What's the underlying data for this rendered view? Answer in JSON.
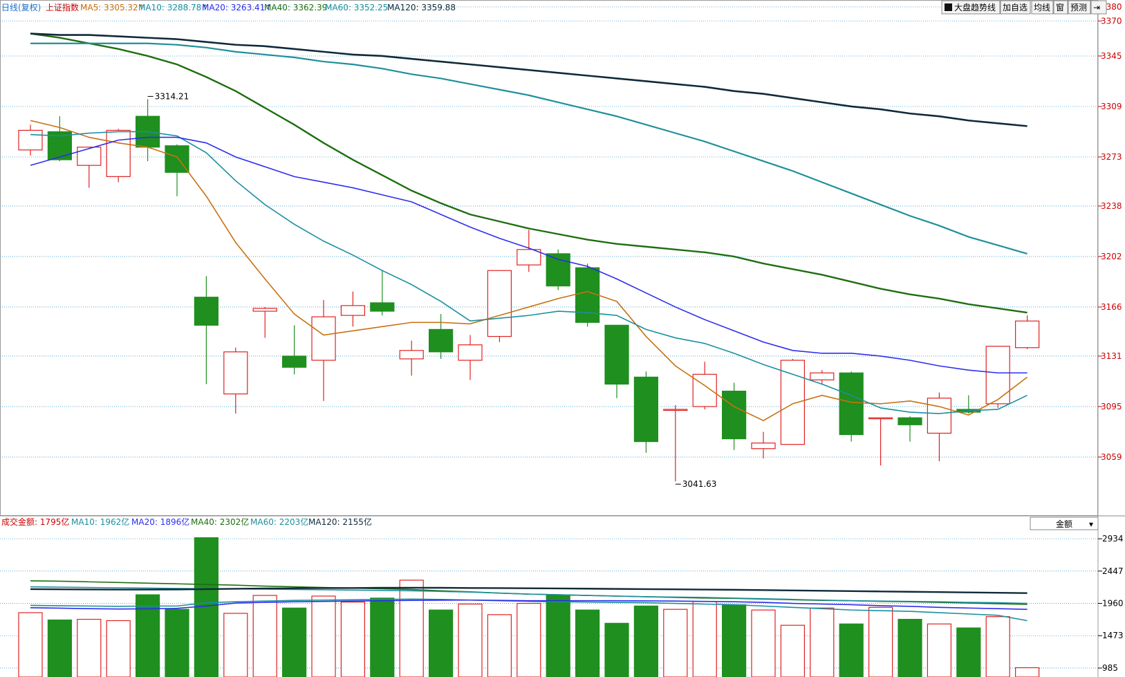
{
  "legend": {
    "period_label": "日线(复权)",
    "index_name": "上证指数",
    "ma5": "MA5: 3305.32↑",
    "ma10": "MA10: 3288.78↑",
    "ma20": "MA20: 3263.41↑",
    "ma40": "MA40: 3362.39",
    "ma60": "MA60: 3352.25",
    "ma120": "MA120: 3359.88"
  },
  "toolbar": {
    "trend_label": "大盘趋势线",
    "add_fav_label": "加自选",
    "ma_label": "均线",
    "window_label": "窗",
    "forecast_label": "预测",
    "exit_label": "⇥"
  },
  "volume_legend": {
    "title": "成交金额: 1795亿",
    "ma10": "MA10: 1962亿",
    "ma20": "MA20: 1896亿",
    "ma40": "MA40: 2302亿",
    "ma60": "MA60: 2203亿",
    "ma120": "MA120: 2155亿",
    "selector_label": "金额"
  },
  "colors": {
    "up": "#e02020",
    "down": "#1f8f1f",
    "ma5": "#c87010",
    "ma10": "#1a8fa0",
    "ma20": "#2c2cf0",
    "ma40": "#1e6e10",
    "ma60": "#1e8f9a",
    "ma120": "#0f2a3a",
    "axis_text": "#cc0000"
  },
  "chart_data": {
    "type": "candlestick",
    "price_axis": {
      "ylim": [
        3020,
        3380
      ],
      "ticks": [
        3380,
        3370,
        3345,
        3309,
        3273,
        3238,
        3202,
        3166,
        3131,
        3095,
        3059
      ]
    },
    "annotations": [
      {
        "text": "3314.21",
        "index": 4,
        "value": 3314.21,
        "type": "high"
      },
      {
        "text": "3041.63",
        "index": 22,
        "value": 3041.63,
        "type": "low"
      }
    ],
    "candles": [
      {
        "o": 3278,
        "h": 3296,
        "l": 3274,
        "c": 3292
      },
      {
        "o": 3291,
        "h": 3302,
        "l": 3270,
        "c": 3271
      },
      {
        "o": 3267,
        "h": 3280,
        "l": 3251,
        "c": 3280
      },
      {
        "o": 3259,
        "h": 3293,
        "l": 3255,
        "c": 3292
      },
      {
        "o": 3302,
        "h": 3314.21,
        "l": 3270,
        "c": 3280
      },
      {
        "o": 3281,
        "h": 3282,
        "l": 3245,
        "c": 3262
      },
      {
        "o": 3173,
        "h": 3188,
        "l": 3111,
        "c": 3153
      },
      {
        "o": 3104,
        "h": 3137,
        "l": 3090,
        "c": 3134
      },
      {
        "o": 3163,
        "h": 3166,
        "l": 3144,
        "c": 3165
      },
      {
        "o": 3131,
        "h": 3153,
        "l": 3118,
        "c": 3123
      },
      {
        "o": 3128,
        "h": 3171,
        "l": 3099,
        "c": 3159
      },
      {
        "o": 3160,
        "h": 3177,
        "l": 3152,
        "c": 3167
      },
      {
        "o": 3169,
        "h": 3192,
        "l": 3160,
        "c": 3163
      },
      {
        "o": 3129,
        "h": 3142,
        "l": 3117,
        "c": 3135
      },
      {
        "o": 3150,
        "h": 3161,
        "l": 3129,
        "c": 3134
      },
      {
        "o": 3128,
        "h": 3146,
        "l": 3114,
        "c": 3139
      },
      {
        "o": 3145,
        "h": 3192,
        "l": 3141,
        "c": 3192
      },
      {
        "o": 3196,
        "h": 3221,
        "l": 3191,
        "c": 3207
      },
      {
        "o": 3204,
        "h": 3207,
        "l": 3178,
        "c": 3181
      },
      {
        "o": 3194,
        "h": 3197,
        "l": 3152,
        "c": 3155
      },
      {
        "o": 3153,
        "h": 3153,
        "l": 3101,
        "c": 3111
      },
      {
        "o": 3116,
        "h": 3120,
        "l": 3062,
        "c": 3070
      },
      {
        "o": 3093,
        "h": 3096,
        "l": 3041.63,
        "c": 3093
      },
      {
        "o": 3095,
        "h": 3127,
        "l": 3093,
        "c": 3118
      },
      {
        "o": 3106,
        "h": 3112,
        "l": 3064,
        "c": 3072
      },
      {
        "o": 3065,
        "h": 3077,
        "l": 3058,
        "c": 3069
      },
      {
        "o": 3068,
        "h": 3129,
        "l": 3068,
        "c": 3128
      },
      {
        "o": 3114,
        "h": 3121,
        "l": 3111,
        "c": 3119
      },
      {
        "o": 3119,
        "h": 3120,
        "l": 3070,
        "c": 3075
      },
      {
        "o": 3087,
        "h": 3087,
        "l": 3053,
        "c": 3087
      },
      {
        "o": 3087,
        "h": 3088,
        "l": 3070,
        "c": 3082
      },
      {
        "o": 3076,
        "h": 3105,
        "l": 3056,
        "c": 3101
      },
      {
        "o": 3093,
        "h": 3103,
        "l": 3090,
        "c": 3091
      },
      {
        "o": 3097,
        "h": 3138,
        "l": 3094,
        "c": 3138
      },
      {
        "o": 3137,
        "h": 3160,
        "l": 3136,
        "c": 3156
      }
    ],
    "ma_series": [
      {
        "name": "MA5",
        "color_key": "ma5",
        "values": [
          3299,
          3294,
          3287,
          3283,
          3280,
          3273,
          3245,
          3212,
          3186,
          3161,
          3146,
          3149,
          3152,
          3155,
          3155,
          3154,
          3160,
          3166,
          3172,
          3177,
          3170,
          3145,
          3124,
          3110,
          3095,
          3085,
          3097,
          3103,
          3098,
          3097,
          3099,
          3095,
          3089,
          3100,
          3116
        ]
      },
      {
        "name": "MA10",
        "color_key": "ma10",
        "values": [
          3289,
          3288,
          3290,
          3291,
          3291,
          3288,
          3276,
          3256,
          3239,
          3225,
          3213,
          3203,
          3192,
          3182,
          3170,
          3156,
          3158,
          3160,
          3163,
          3162,
          3160,
          3150,
          3144,
          3140,
          3133,
          3125,
          3118,
          3111,
          3103,
          3094,
          3091,
          3090,
          3092,
          3093,
          3103
        ]
      },
      {
        "name": "MA20",
        "color_key": "ma20",
        "values": [
          3267,
          3273,
          3279,
          3285,
          3287,
          3287,
          3283,
          3273,
          3266,
          3259,
          3255,
          3251,
          3246,
          3241,
          3232,
          3223,
          3215,
          3208,
          3200,
          3195,
          3186,
          3176,
          3166,
          3157,
          3149,
          3141,
          3135,
          3133,
          3133,
          3131,
          3128,
          3124,
          3121,
          3119,
          3119
        ]
      },
      {
        "name": "MA40",
        "color_key": "ma40",
        "values": [
          3361,
          3358,
          3354,
          3350,
          3345,
          3339,
          3330,
          3320,
          3308,
          3296,
          3283,
          3271,
          3260,
          3249,
          3240,
          3232,
          3227,
          3222,
          3218,
          3214,
          3211,
          3209,
          3207,
          3205,
          3202,
          3197,
          3193,
          3189,
          3184,
          3179,
          3175,
          3172,
          3168,
          3165,
          3162
        ]
      },
      {
        "name": "MA60",
        "color_key": "ma60",
        "values": [
          3354,
          3354,
          3354,
          3354,
          3354,
          3353,
          3351,
          3348,
          3346,
          3344,
          3341,
          3339,
          3336,
          3332,
          3329,
          3325,
          3321,
          3317,
          3312,
          3307,
          3302,
          3296,
          3290,
          3284,
          3277,
          3270,
          3263,
          3255,
          3247,
          3239,
          3231,
          3224,
          3216,
          3210,
          3204
        ]
      },
      {
        "name": "MA120",
        "color_key": "ma120",
        "values": [
          3361,
          3360,
          3360,
          3359,
          3358,
          3357,
          3355,
          3353,
          3352,
          3350,
          3348,
          3346,
          3345,
          3343,
          3341,
          3339,
          3337,
          3335,
          3333,
          3331,
          3329,
          3327,
          3325,
          3323,
          3320,
          3318,
          3315,
          3312,
          3309,
          3307,
          3304,
          3302,
          3299,
          3297,
          3295
        ]
      }
    ],
    "volume": {
      "title": "成交金额",
      "unit": "亿",
      "ylim": [
        850,
        3050
      ],
      "ticks": [
        2934,
        2447,
        1960,
        1473,
        985
      ],
      "values": [
        1820,
        1710,
        1720,
        1700,
        2090,
        1870,
        2950,
        1810,
        2080,
        1890,
        2070,
        1980,
        2040,
        2310,
        1860,
        1950,
        1790,
        1960,
        2080,
        1860,
        1660,
        1920,
        1870,
        1990,
        1940,
        1860,
        1630,
        1890,
        1650,
        1900,
        1720,
        1650,
        1590,
        1760,
        990
      ],
      "ma_series": [
        {
          "name": "MA10",
          "color_key": "ma10",
          "values": [
            1930,
            1925,
            1920,
            1915,
            1920,
            1920,
            1970,
            1985,
            1995,
            2005,
            2010,
            2015,
            2020,
            2025,
            2020,
            2010,
            2000,
            1990,
            1985,
            1980,
            1975,
            1970,
            1960,
            1950,
            1940,
            1920,
            1900,
            1880,
            1860,
            1850,
            1840,
            1820,
            1800,
            1780,
            1700
          ]
        },
        {
          "name": "MA20",
          "color_key": "ma20",
          "values": [
            1895,
            1888,
            1880,
            1875,
            1878,
            1885,
            1920,
            1965,
            1975,
            1985,
            1990,
            1995,
            2000,
            2005,
            2008,
            2010,
            2005,
            2000,
            2000,
            2000,
            2000,
            1998,
            1995,
            1990,
            1985,
            1975,
            1960,
            1950,
            1940,
            1925,
            1915,
            1900,
            1890,
            1880,
            1870
          ]
        },
        {
          "name": "MA40",
          "color_key": "ma40",
          "values": [
            2300,
            2295,
            2285,
            2275,
            2265,
            2255,
            2245,
            2235,
            2220,
            2210,
            2200,
            2190,
            2180,
            2170,
            2150,
            2135,
            2115,
            2100,
            2090,
            2080,
            2070,
            2060,
            2050,
            2040,
            2035,
            2025,
            2015,
            2005,
            2000,
            1990,
            1985,
            1975,
            1965,
            1955,
            1945
          ]
        },
        {
          "name": "MA60",
          "color_key": "ma60",
          "values": [
            2210,
            2205,
            2200,
            2195,
            2190,
            2185,
            2180,
            2178,
            2175,
            2170,
            2165,
            2160,
            2155,
            2150,
            2140,
            2130,
            2115,
            2100,
            2090,
            2080,
            2070,
            2060,
            2055,
            2050,
            2040,
            2030,
            2020,
            2010,
            2000,
            1995,
            1990,
            1985,
            1975,
            1970,
            1960
          ]
        },
        {
          "name": "MA120",
          "color_key": "ma120",
          "values": [
            2175,
            2172,
            2170,
            2168,
            2168,
            2170,
            2175,
            2180,
            2185,
            2188,
            2190,
            2192,
            2195,
            2196,
            2195,
            2192,
            2190,
            2188,
            2185,
            2182,
            2178,
            2175,
            2172,
            2168,
            2165,
            2160,
            2155,
            2150,
            2145,
            2140,
            2135,
            2130,
            2125,
            2120,
            2115
          ]
        }
      ]
    }
  }
}
